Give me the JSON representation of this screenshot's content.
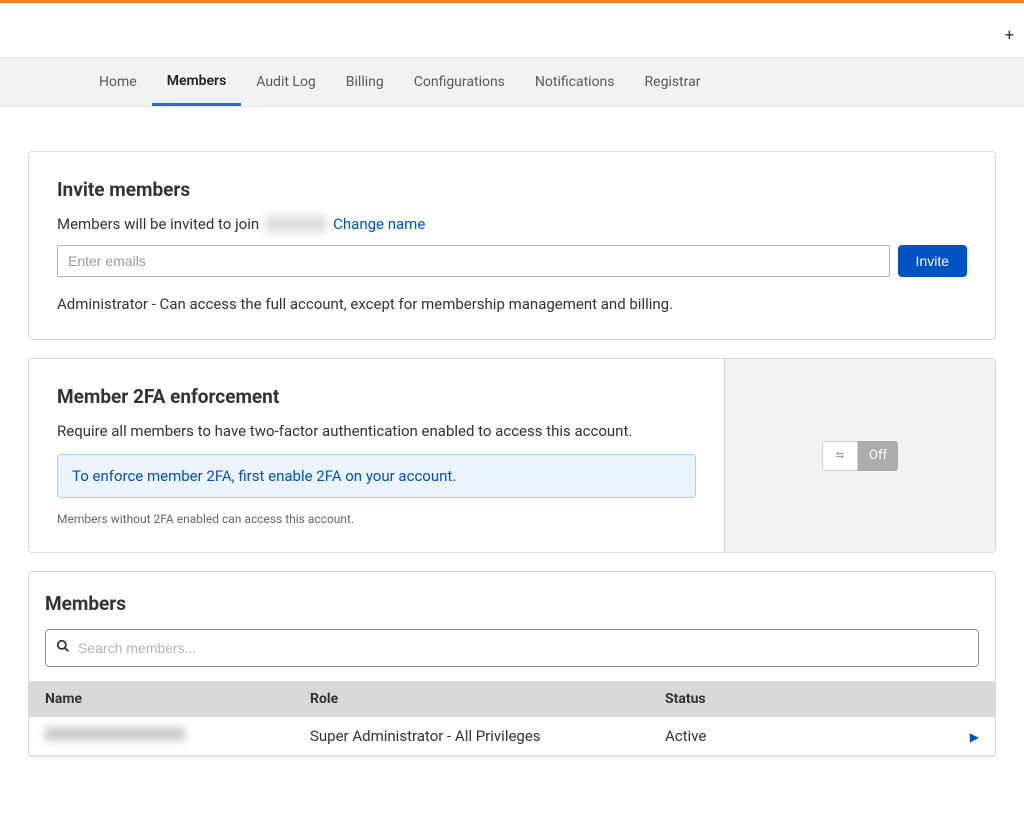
{
  "nav": {
    "tabs": [
      {
        "label": "Home"
      },
      {
        "label": "Members"
      },
      {
        "label": "Audit Log"
      },
      {
        "label": "Billing"
      },
      {
        "label": "Configurations"
      },
      {
        "label": "Notifications"
      },
      {
        "label": "Registrar"
      }
    ],
    "active_index": 1
  },
  "invite": {
    "title": "Invite members",
    "text_prefix": "Members will be invited to join",
    "change_name": "Change name",
    "email_placeholder": "Enter emails",
    "button": "Invite",
    "role_desc": "Administrator - Can access the full account, except for membership management and billing."
  },
  "twofa": {
    "title": "Member 2FA enforcement",
    "desc": "Require all members to have two-factor authentication enabled to access this account.",
    "info_prefix": "To enforce member 2FA, first enable 2FA on ",
    "info_link": "your account",
    "info_suffix": ".",
    "small_note": "Members without 2FA enabled can access this account.",
    "toggle_off": "Off"
  },
  "members": {
    "title": "Members",
    "search_placeholder": "Search members...",
    "columns": {
      "name": "Name",
      "role": "Role",
      "status": "Status"
    },
    "rows": [
      {
        "role": "Super Administrator - All Privileges",
        "status": "Active"
      }
    ]
  }
}
